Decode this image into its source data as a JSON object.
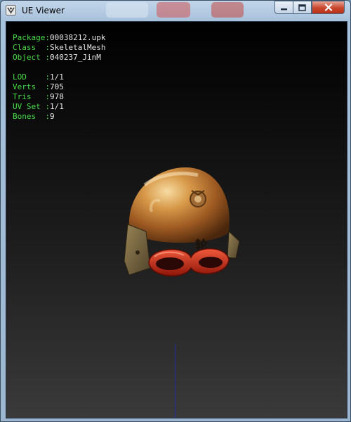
{
  "window": {
    "title": "UE Viewer",
    "controls": {
      "minimize": "minimize",
      "maximize": "maximize",
      "close": "close"
    }
  },
  "info": {
    "package": {
      "label": "Package:",
      "value": "00038212.upk"
    },
    "class": {
      "label": "Class  :",
      "value": "SkeletalMesh"
    },
    "object": {
      "label": "Object :",
      "value": "040237_JinM"
    },
    "lod": {
      "label": "LOD    :",
      "value": "1/1"
    },
    "verts": {
      "label": "Verts  :",
      "value": "705"
    },
    "tris": {
      "label": "Tris   :",
      "value": "978"
    },
    "uvset": {
      "label": "UV Set :",
      "value": "1/1"
    },
    "bones": {
      "label": "Bones  :",
      "value": "9"
    }
  },
  "colors": {
    "label_green": "#48dd48",
    "value_white": "#e8e8e8",
    "viewport_top": "#000000",
    "viewport_bottom": "#3a3a3a",
    "axis_blue": "#1f2aa8"
  },
  "icons": {
    "app": "ue-viewer-app-icon",
    "helmet": "helmet-model",
    "helmet_emblem_glyph": "轮"
  }
}
